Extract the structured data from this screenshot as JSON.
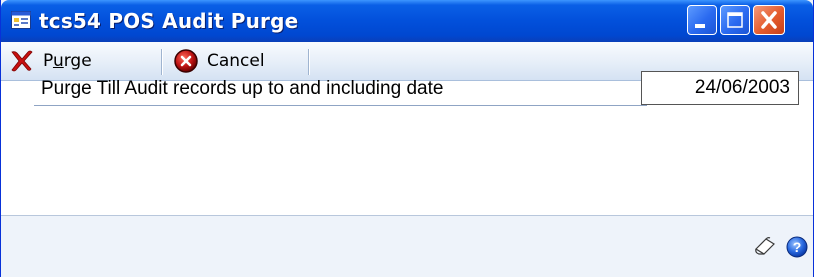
{
  "window": {
    "title": "tcs54 POS Audit Purge",
    "title_icon": "window-form-icon",
    "controls": {
      "minimize_icon": "minimize-icon",
      "maximize_icon": "maximize-icon",
      "close_icon": "close-icon"
    }
  },
  "toolbar": {
    "purge": {
      "label_prefix": "P",
      "label_mnemonic": "u",
      "label_suffix": "rge",
      "icon": "red-x-icon"
    },
    "cancel": {
      "label": "Cancel",
      "icon": "cancel-circle-icon"
    }
  },
  "form": {
    "prompt_label": "Purge Till Audit records up to and including date",
    "date_value": "24/06/2003"
  },
  "statusbar": {
    "note_icon": "note-icon",
    "help_icon": "help-icon"
  },
  "colors": {
    "titlebar": "#0250db",
    "toolbar_bg": "#e6eef8",
    "content_bg": "#ffffff",
    "footer_bg": "#eef3fa",
    "close_button": "#e45b2d"
  }
}
